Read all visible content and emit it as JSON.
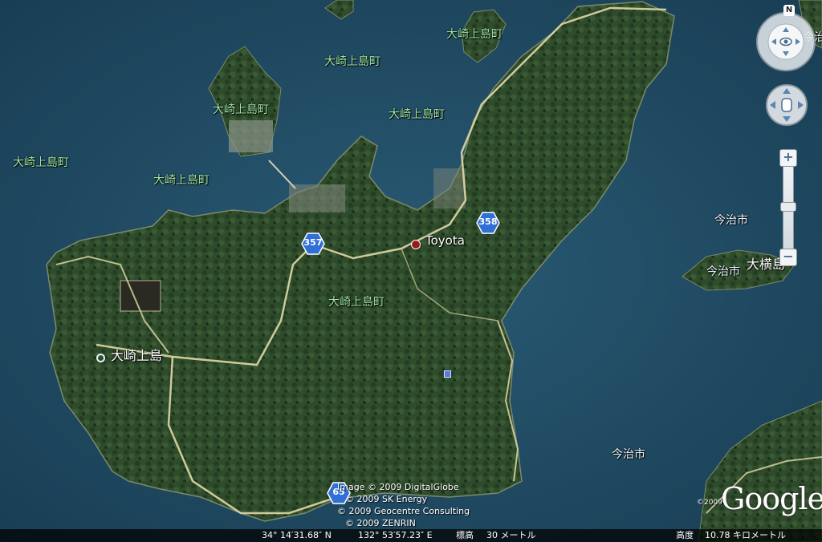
{
  "map": {
    "labels": {
      "town_label_1": "大崎上島町",
      "town_label_2": "大崎上島町",
      "town_label_3": "大崎上島町",
      "town_label_4": "大崎上島町",
      "town_label_5": "大崎上島町",
      "town_label_6": "大崎上島町",
      "town_label_7": "大崎上島町",
      "city_label_1": "今治市",
      "city_label_2": "今治市",
      "city_label_3": "今治市",
      "city_label_partial": "今治",
      "island_label_partial": "大横島"
    },
    "places": {
      "island_name": "大崎上島",
      "toyota": "Toyota"
    },
    "routes": {
      "route_357": "357",
      "route_358": "358",
      "route_65": "65"
    }
  },
  "credits": {
    "line1": "Image © 2009 DigitalGlobe",
    "line2": "© 2009 SK Energy",
    "line3": "© 2009 Geocentre Consulting",
    "line4": "© 2009 ZENRIN"
  },
  "branding": {
    "google_logo": "Google",
    "logo_year": "©2009"
  },
  "status": {
    "latitude": "34° 14′31.68″ N",
    "longitude": "132° 53′57.23″ E",
    "elevation_label": "標高",
    "elevation_value": "30 メートル",
    "eye_alt_label": "高度",
    "eye_alt_value": "10.78 キロメートル"
  },
  "nav": {
    "north_label": "N",
    "zoom_in": "+",
    "zoom_out": "−"
  },
  "colors": {
    "sea": "#1f4a63",
    "land_forest": "#2c4a2a",
    "road": "#e0d9a6",
    "route_shield": "#2f6fd6",
    "town_label": "#9fe6a6"
  }
}
